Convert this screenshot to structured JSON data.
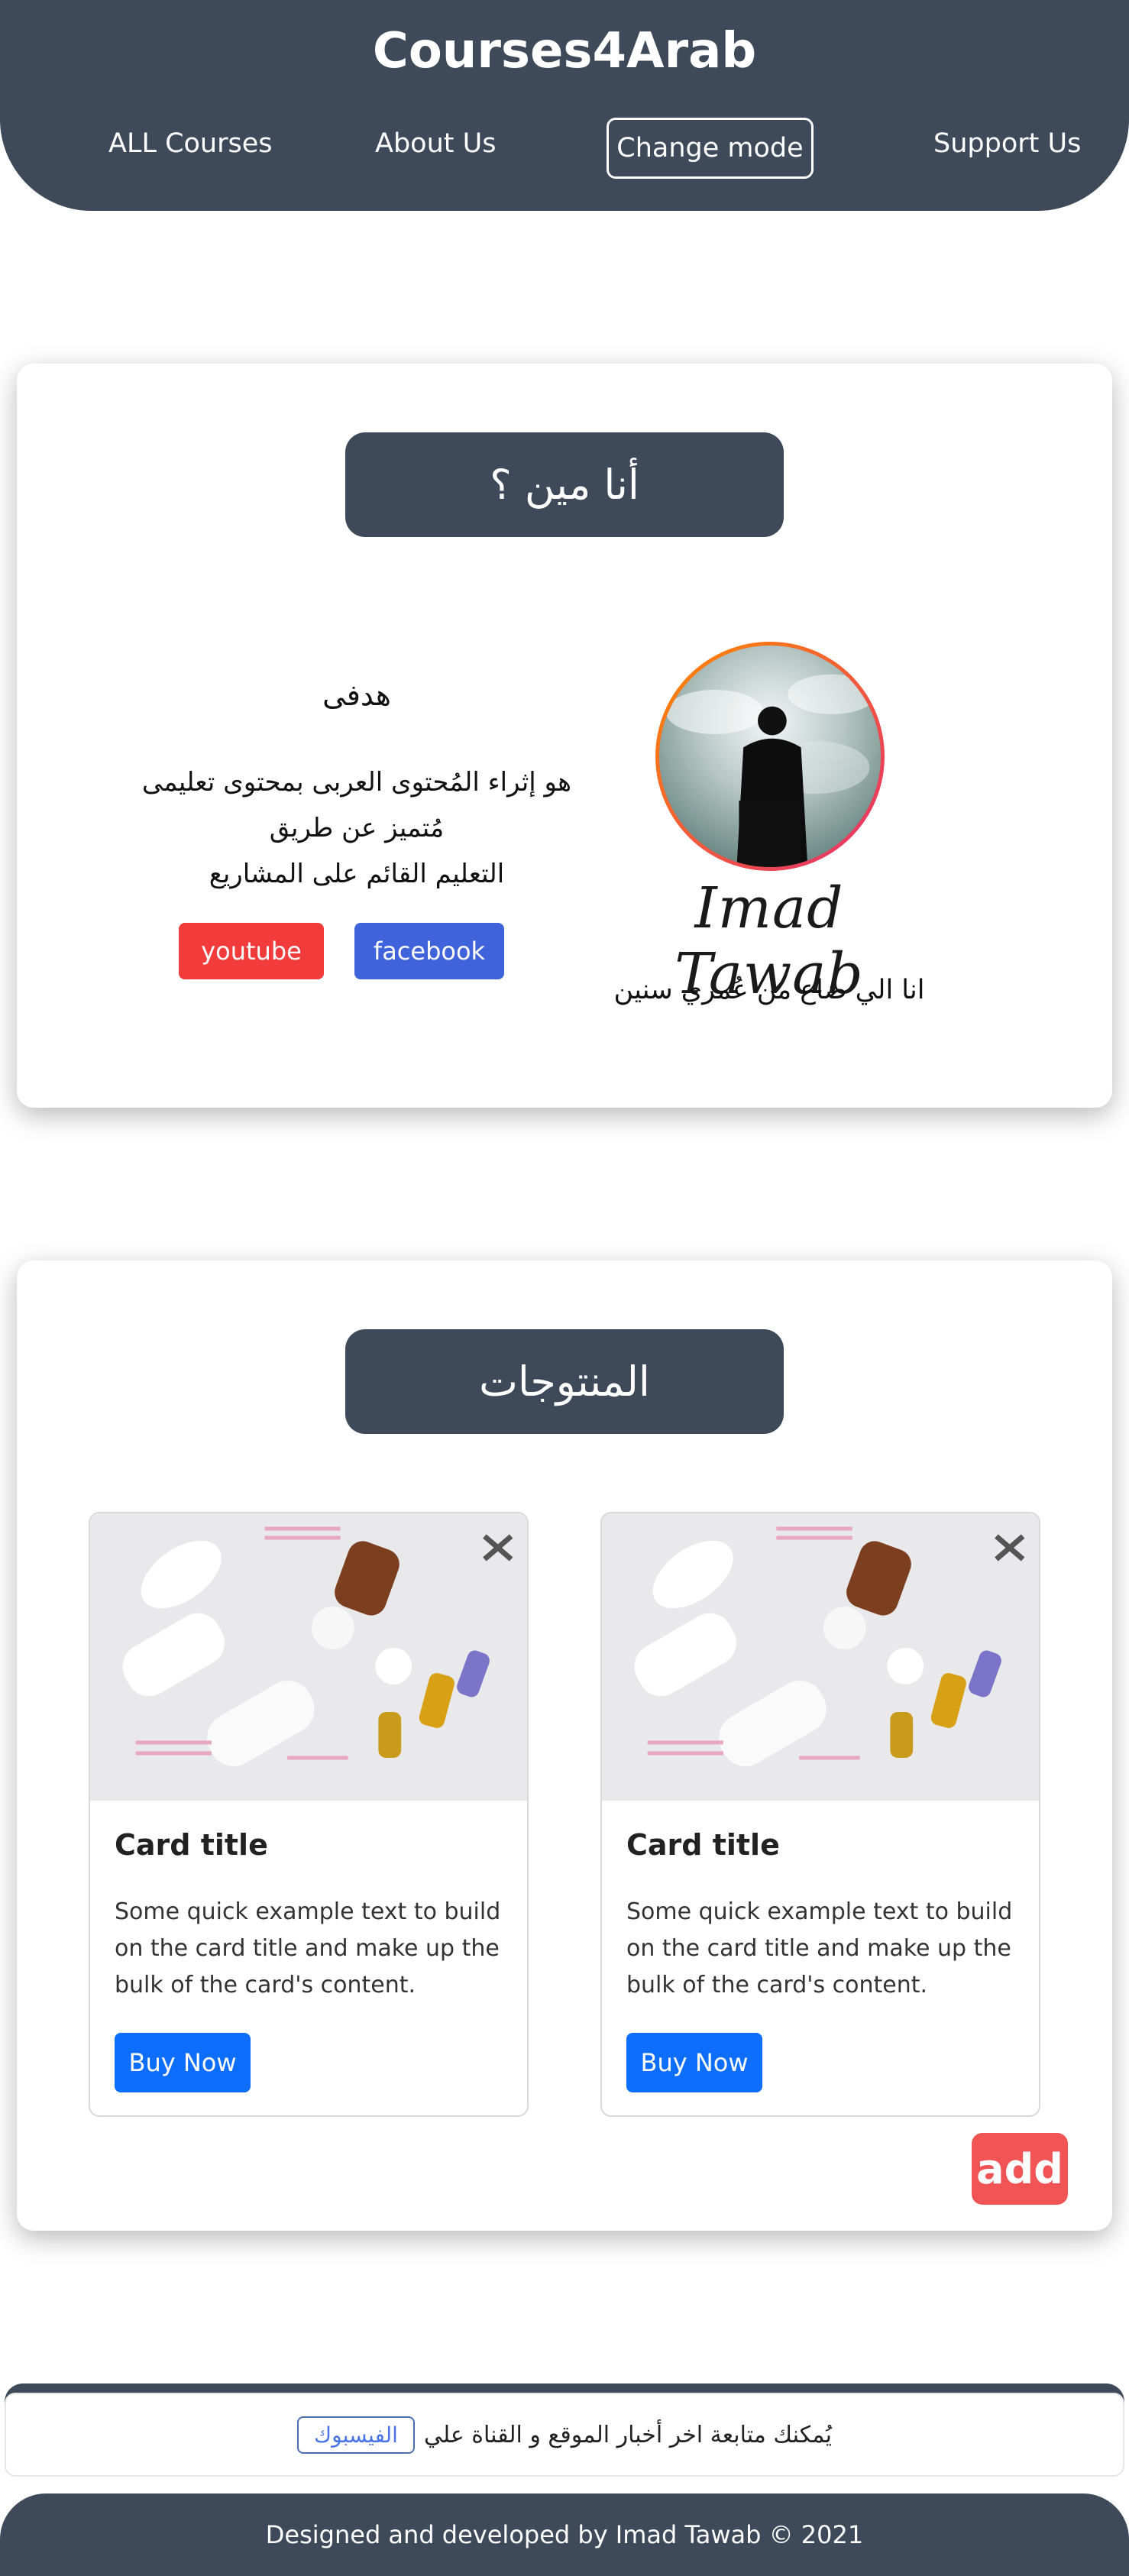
{
  "header": {
    "brand": "Courses4Arab",
    "nav": {
      "all_courses": "ALL Courses",
      "about_us": "About Us",
      "change_mode": "Change mode",
      "support_us": "Support Us"
    }
  },
  "about": {
    "heading": "أنا مين ؟",
    "goal_title": "هدفى",
    "goal_text_line1": "هو إثراء المُحتوى العربى بمحتوى تعليمى",
    "goal_text_line2": "مُتميز عن طريق",
    "goal_text_line3": "التعليم القائم على المشاريع",
    "youtube_label": "youtube",
    "facebook_label": "facebook",
    "author_name": "Imad Tawab",
    "author_quote": "انا الي ضاع من عُمري سنين",
    "colors": {
      "youtube": "#f23b3b",
      "facebook": "#3f63db"
    }
  },
  "products": {
    "heading": "المنتوجات",
    "cards": [
      {
        "title": "Card title",
        "text": "Some quick example text to build on the card title and make up the bulk of the card's content.",
        "button": "Buy Now"
      },
      {
        "title": "Card title",
        "text": "Some quick example text to build on the card title and make up the bulk of the card's content.",
        "button": "Buy Now"
      }
    ],
    "add_label": "add"
  },
  "follow": {
    "text": "يُمكنك متابعة اخر أخبار الموقع و القناة علي",
    "link_label": "الفيسبوك"
  },
  "footer": {
    "text": "Designed and developed by Imad Tawab © 2021"
  },
  "theme": {
    "primary_dark": "#3e4a5a",
    "button_blue": "#0d6efd",
    "add_red": "#f05454"
  }
}
